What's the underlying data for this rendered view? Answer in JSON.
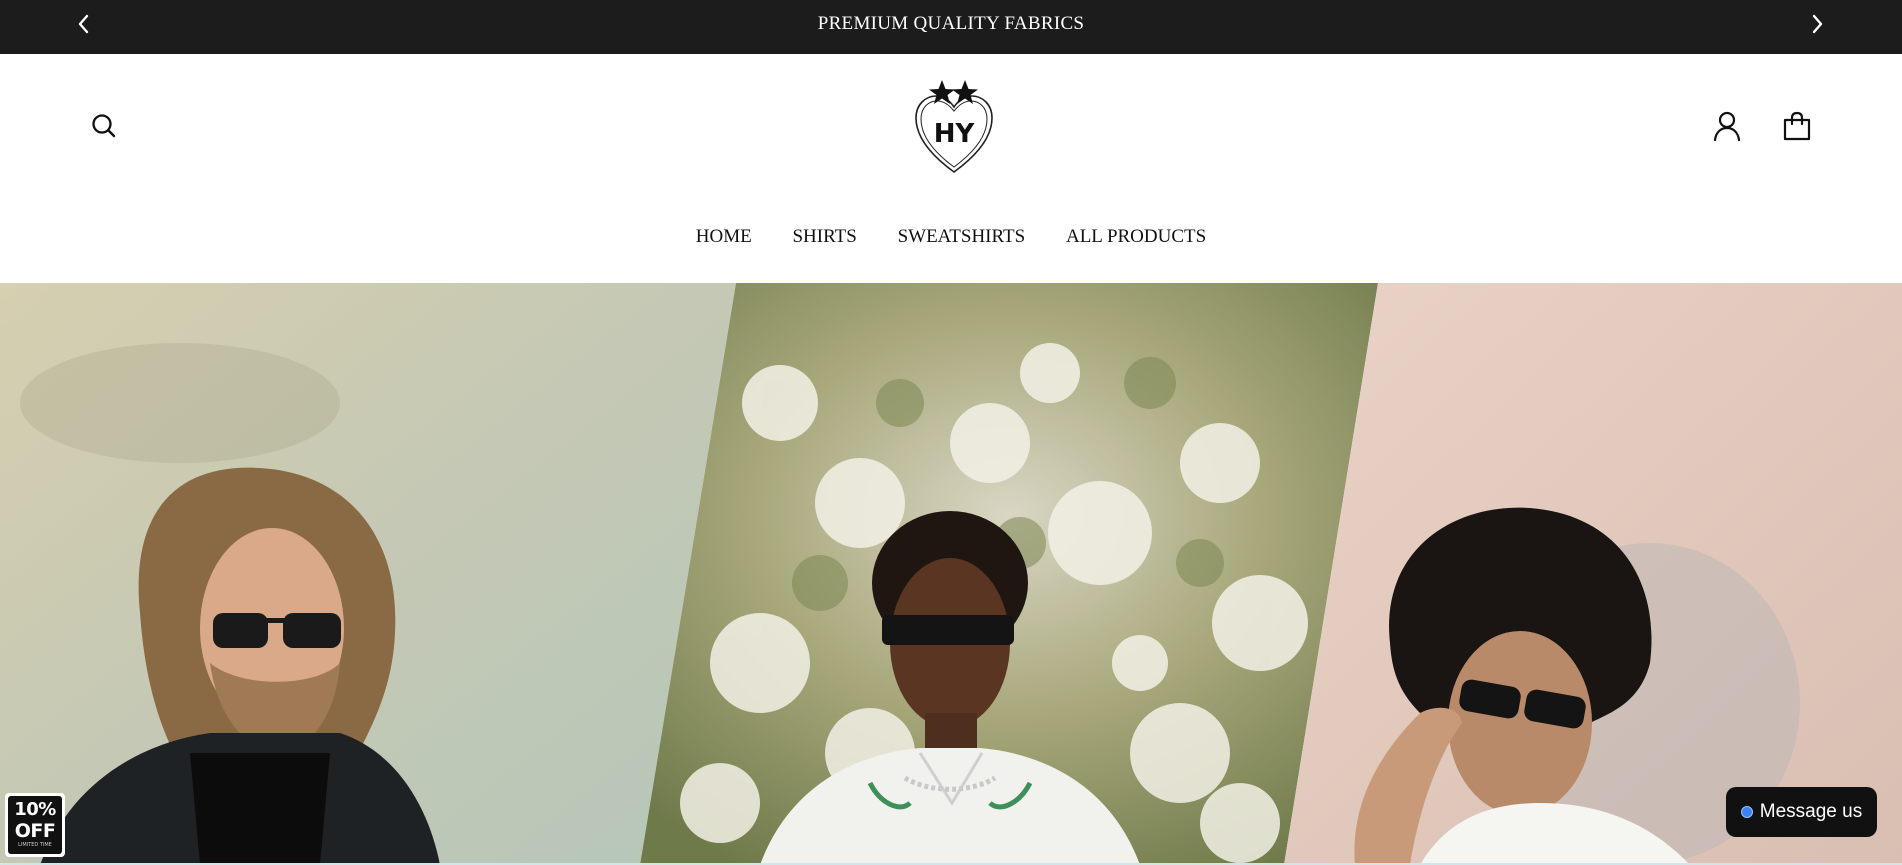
{
  "announcement": {
    "text": "PREMIUM QUALITY FABRICS",
    "prev_icon": "chevron-left-icon",
    "next_icon": "chevron-right-icon"
  },
  "header": {
    "logo_text": "HY",
    "search_icon": "search-icon",
    "account_icon": "user-icon",
    "cart_icon": "shopping-bag-icon"
  },
  "nav": {
    "items": [
      {
        "label": "HOME"
      },
      {
        "label": "SHIRTS"
      },
      {
        "label": "SWEATSHIRTS"
      },
      {
        "label": "ALL PRODUCTS"
      }
    ]
  },
  "badge": {
    "top": "10%",
    "bottom": "OFF",
    "fine": "LIMITED TIME"
  },
  "chat": {
    "label": "Message us"
  },
  "colors": {
    "announce_bg": "#1c1c1c",
    "chat_bg": "#111111",
    "chat_dot": "#3b82f6"
  }
}
